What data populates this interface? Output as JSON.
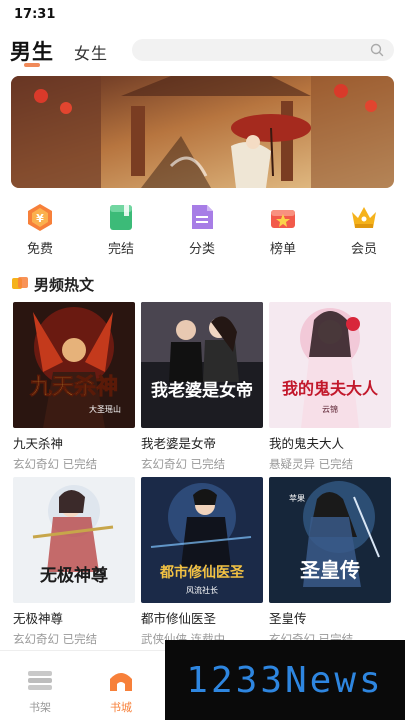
{
  "status_bar": {
    "time": "17:31"
  },
  "nav": {
    "tab_male": "男生",
    "tab_female": "女生",
    "search_placeholder": ""
  },
  "quick_nav": [
    {
      "label": "免费",
      "icon": "yuan-hexagon-icon",
      "color": "#f7803a"
    },
    {
      "label": "完结",
      "icon": "green-book-icon",
      "color": "#3cbb78"
    },
    {
      "label": "分类",
      "icon": "document-list-icon",
      "color": "#a77de6"
    },
    {
      "label": "榜单",
      "icon": "ranking-flag-icon",
      "color": "#f25a4a"
    },
    {
      "label": "会员",
      "icon": "crown-icon",
      "color": "#f5b21b"
    }
  ],
  "section": {
    "title": "男频热文"
  },
  "books": [
    {
      "title": "九天杀神",
      "meta": "玄幻奇幻 已完结",
      "cover_text": "九天杀神",
      "cover_sub": "大圣瑶山"
    },
    {
      "title": "我老婆是女帝",
      "meta": "玄幻奇幻 已完结",
      "cover_text": "我老婆是女帝",
      "cover_sub": ""
    },
    {
      "title": "我的鬼夫大人",
      "meta": "悬疑灵异 已完结",
      "cover_text": "我的鬼夫大人",
      "cover_sub": "云锦"
    },
    {
      "title": "无极神尊",
      "meta": "玄幻奇幻 已完结",
      "cover_text": "无极神尊",
      "cover_sub": ""
    },
    {
      "title": "都市修仙医圣",
      "meta": "武侠仙侠 连载中",
      "cover_text": "都市修仙医圣",
      "cover_sub": "风流社长"
    },
    {
      "title": "圣皇传",
      "meta": "玄幻奇幻 已完结",
      "cover_text": "圣皇传",
      "cover_sub": "苹果"
    }
  ],
  "bottom_nav": {
    "peek_text": "",
    "items": [
      {
        "label": "书架",
        "icon": "bookshelf-icon",
        "color": "#bbbbbb"
      },
      {
        "label": "书城",
        "icon": "bookstore-icon",
        "color": "#f7803a"
      }
    ]
  },
  "watermark": {
    "text": "1233News"
  },
  "colors": {
    "accent": "#f08a5a",
    "meta_text": "#999999"
  }
}
